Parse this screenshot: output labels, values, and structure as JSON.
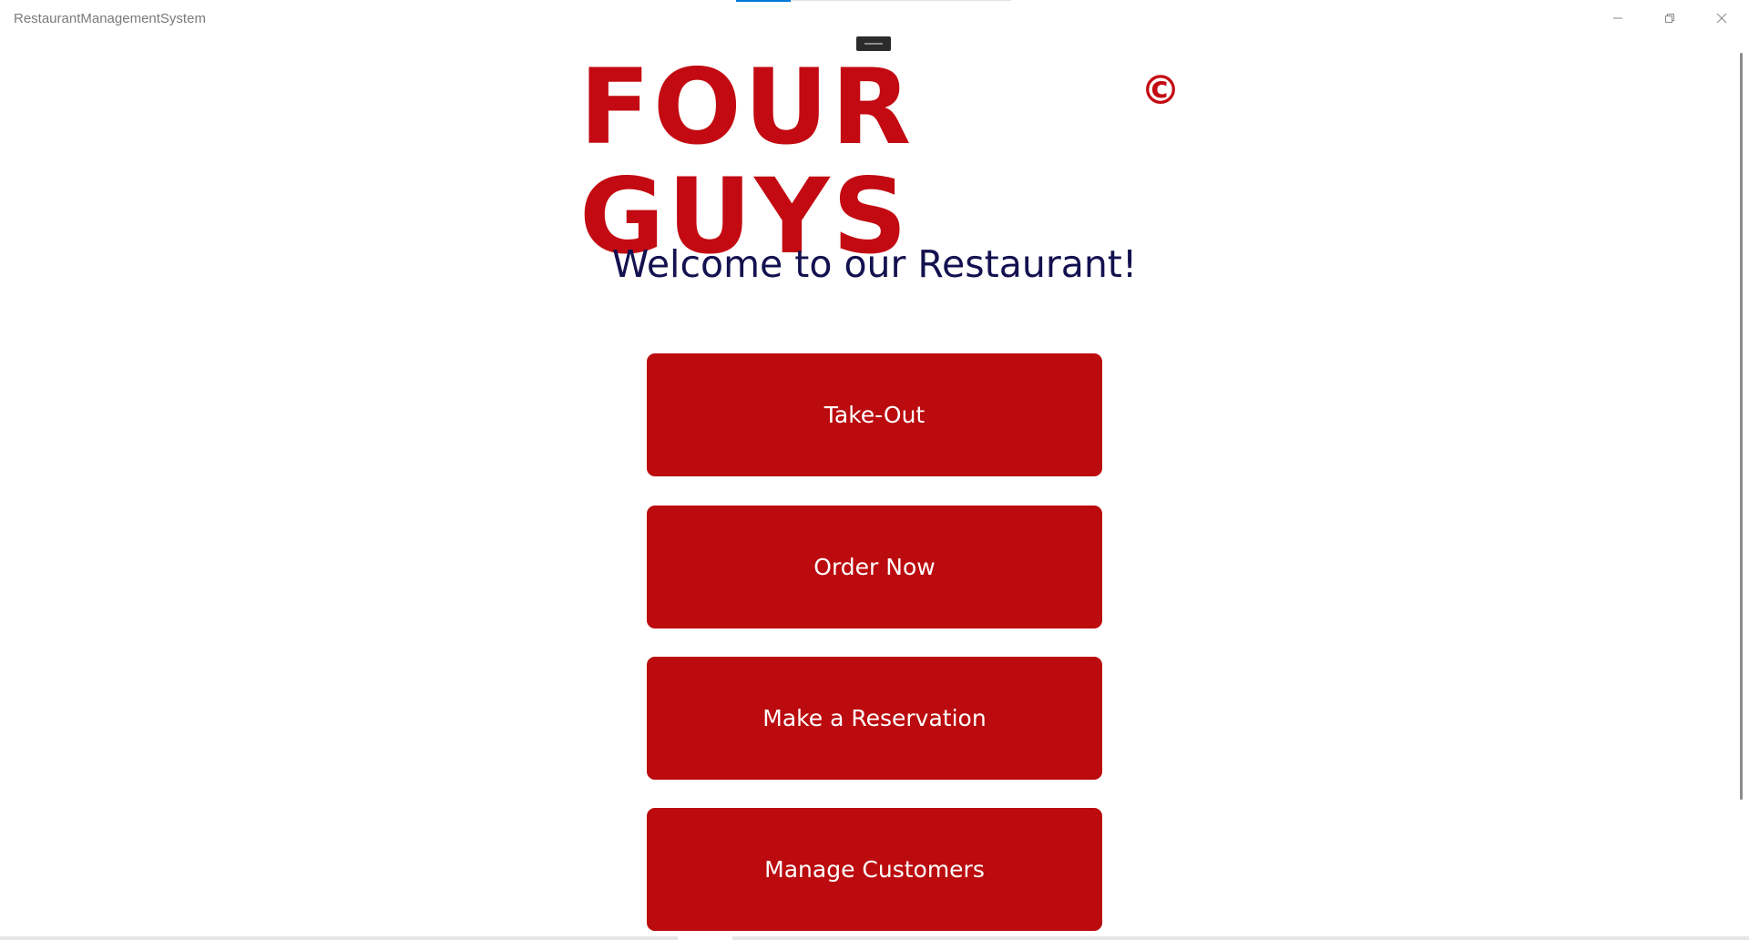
{
  "window": {
    "title": "RestaurantManagementSystem",
    "controls": {
      "minimize_icon": "minimize-icon",
      "restore_icon": "restore-icon",
      "close_icon": "close-icon"
    }
  },
  "logo": {
    "text": "FOUR GUYS",
    "mark": "©",
    "color": "#c30a12"
  },
  "welcome": {
    "text": "Welcome to our Restaurant!",
    "color": "#13114f"
  },
  "menu": {
    "button_color": "#bb0b0e",
    "takeout_label": "Take-Out",
    "order_label": "Order Now",
    "reservation_label": "Make a Reservation",
    "customers_label": "Manage Customers"
  }
}
